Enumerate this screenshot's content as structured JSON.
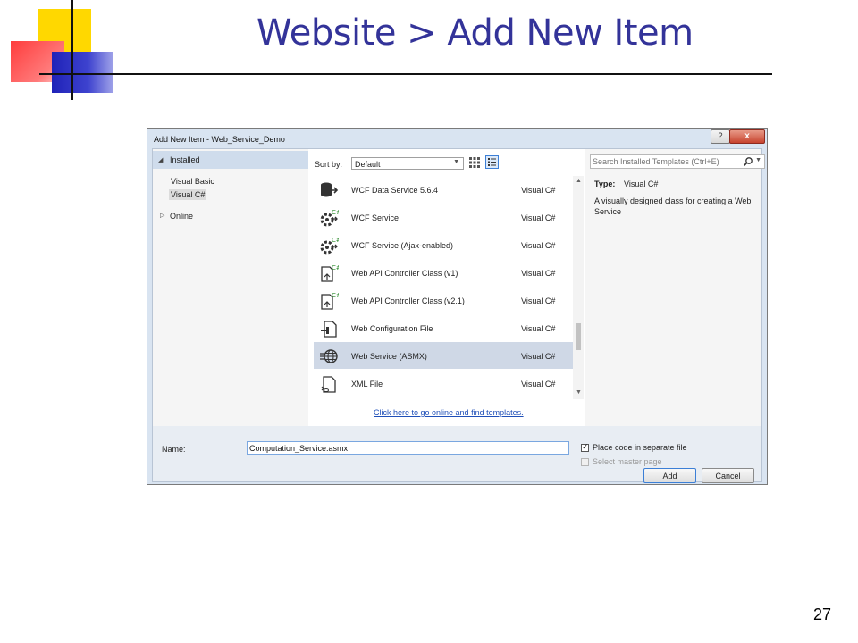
{
  "slide": {
    "title": "Website > Add New Item",
    "page_number": "27"
  },
  "dialog": {
    "title": "Add New Item - Web_Service_Demo",
    "help_label": "?",
    "close_label": "x",
    "tree": {
      "installed": "Installed",
      "children": [
        "Visual Basic",
        "Visual C#"
      ],
      "selected": "Visual C#",
      "online": "Online"
    },
    "sort_by_label": "Sort by:",
    "sort_by_value": "Default",
    "search_placeholder": "Search Installed Templates (Ctrl+E)",
    "templates": [
      {
        "name": "WCF Data Service 5.6.4",
        "language": "Visual C#",
        "icon": "data-service-icon"
      },
      {
        "name": "WCF Service",
        "language": "Visual C#",
        "icon": "wcf-service-icon"
      },
      {
        "name": "WCF Service (Ajax-enabled)",
        "language": "Visual C#",
        "icon": "wcf-ajax-service-icon"
      },
      {
        "name": "Web API Controller Class (v1)",
        "language": "Visual C#",
        "icon": "web-api-controller-icon"
      },
      {
        "name": "Web API Controller Class (v2.1)",
        "language": "Visual C#",
        "icon": "web-api-controller-icon"
      },
      {
        "name": "Web Configuration File",
        "language": "Visual C#",
        "icon": "web-config-icon"
      },
      {
        "name": "Web Service (ASMX)",
        "language": "Visual C#",
        "icon": "web-service-globe-icon",
        "selected": true
      },
      {
        "name": "XML File",
        "language": "Visual C#",
        "icon": "xml-file-icon"
      }
    ],
    "online_link": "Click here to go online and find templates.",
    "details": {
      "type_label": "Type:",
      "type_value": "Visual C#",
      "description": "A visually designed class for creating a Web Service"
    },
    "name_label": "Name:",
    "name_value": "Computation_Service.asmx",
    "place_code_label": "Place code in separate file",
    "place_code_checked": true,
    "master_page_label": "Select master page",
    "master_page_enabled": false,
    "add_label": "Add",
    "cancel_label": "Cancel"
  }
}
